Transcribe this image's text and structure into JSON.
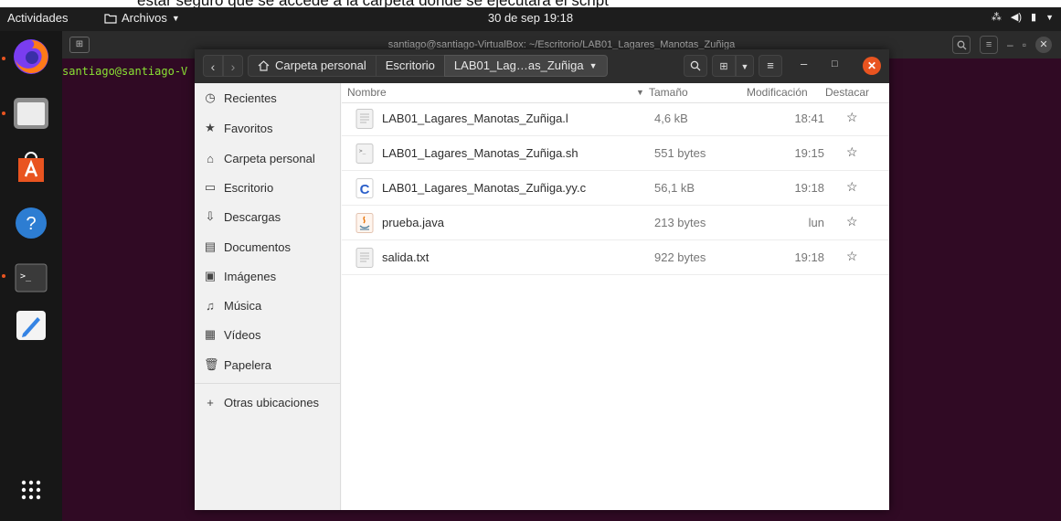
{
  "doc_strip_text": "estar seguro que se accede a la carpeta donde se ejecutará el script",
  "topbar": {
    "activities": "Actividades",
    "app_menu": "Archivos",
    "clock": "30 de sep  19:18"
  },
  "terminal": {
    "title": "santiago@santiago-VirtualBox: ~/Escritorio/LAB01_Lagares_Manotas_Zuñiga",
    "prompt": "santiago@santiago-V"
  },
  "dock": {
    "items": [
      "firefox-icon",
      "files-icon",
      "software-icon",
      "help-icon",
      "terminal-icon",
      "text-editor-icon",
      "show-apps-icon"
    ]
  },
  "file_manager": {
    "breadcrumbs": {
      "home": "Carpeta personal",
      "desktop": "Escritorio",
      "current": "LAB01_Lag…as_Zuñiga"
    },
    "sidebar": [
      {
        "label": "Recientes",
        "icon": "clock-icon"
      },
      {
        "label": "Favoritos",
        "icon": "star-icon"
      },
      {
        "label": "Carpeta personal",
        "icon": "home-icon"
      },
      {
        "label": "Escritorio",
        "icon": "desktop-icon"
      },
      {
        "label": "Descargas",
        "icon": "download-icon"
      },
      {
        "label": "Documentos",
        "icon": "document-icon"
      },
      {
        "label": "Imágenes",
        "icon": "image-icon"
      },
      {
        "label": "Música",
        "icon": "music-icon"
      },
      {
        "label": "Vídeos",
        "icon": "video-icon"
      },
      {
        "label": "Papelera",
        "icon": "trash-icon"
      },
      {
        "label": "Otras ubicaciones",
        "icon": "plus-icon"
      }
    ],
    "columns": {
      "name": "Nombre",
      "size": "Tamaño",
      "modified": "Modificación",
      "starred": "Destacar"
    },
    "files": [
      {
        "name": "LAB01_Lagares_Manotas_Zuñiga.l",
        "size": "4,6 kB",
        "modified": "18:41",
        "type": "text"
      },
      {
        "name": "LAB01_Lagares_Manotas_Zuñiga.sh",
        "size": "551 bytes",
        "modified": "19:15",
        "type": "script"
      },
      {
        "name": "LAB01_Lagares_Manotas_Zuñiga.yy.c",
        "size": "56,1 kB",
        "modified": "19:18",
        "type": "c-source"
      },
      {
        "name": "prueba.java",
        "size": "213 bytes",
        "modified": "lun",
        "type": "java"
      },
      {
        "name": "salida.txt",
        "size": "922 bytes",
        "modified": "19:18",
        "type": "text"
      }
    ]
  },
  "colors": {
    "desktop": "#2c001e",
    "terminal_bg": "#300a24",
    "accent": "#e95420",
    "prompt": "#8ae234"
  }
}
